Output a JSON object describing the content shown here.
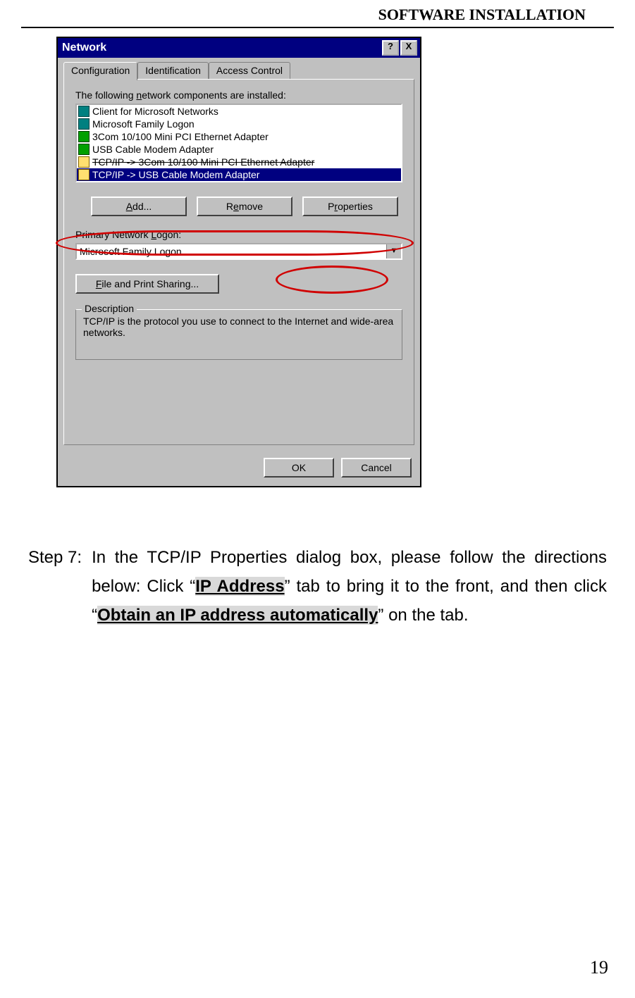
{
  "page": {
    "header": "SOFTWARE INSTALLATION",
    "number": "19"
  },
  "dialog": {
    "title": "Network",
    "helpBtn": "?",
    "closeBtn": "X",
    "tabs": {
      "configuration": "Configuration",
      "identification": "Identification",
      "accessControl": "Access Control"
    },
    "componentsLabelPre": "The following ",
    "componentsLabelUnder": "n",
    "componentsLabelPost": "etwork components are installed:",
    "components": [
      "Client for Microsoft Networks",
      "Microsoft Family Logon",
      "3Com 10/100 Mini PCI Ethernet Adapter",
      "USB Cable Modem Adapter",
      "TCP/IP -> 3Com 10/100 Mini PCI Ethernet Adapter",
      "TCP/IP -> USB Cable Modem Adapter"
    ],
    "buttons": {
      "addUnder": "A",
      "addRest": "dd...",
      "removePre": "R",
      "removeUnder": "e",
      "removePost": "move",
      "propPre": "P",
      "propUnder": "r",
      "propPost": "operties"
    },
    "primaryLogon": {
      "labelPre": "Primary Network ",
      "labelUnder": "L",
      "labelPost": "ogon:",
      "value": "Microsoft Family Logon"
    },
    "fileShare": {
      "under": "F",
      "rest": "ile and Print Sharing..."
    },
    "description": {
      "legend": "Description",
      "text": "TCP/IP is the protocol you use to connect to the Internet and wide-area networks."
    },
    "footer": {
      "ok": "OK",
      "cancel": "Cancel"
    }
  },
  "step": {
    "label": "Step 7:",
    "pre": "In the TCP/IP Properties dialog box, please follow the directions below: Click “",
    "hl1": "IP Address",
    "mid": "” tab to bring it to the front, and then click “",
    "hl2": "Obtain an IP address automatically",
    "post": "” on the tab."
  }
}
